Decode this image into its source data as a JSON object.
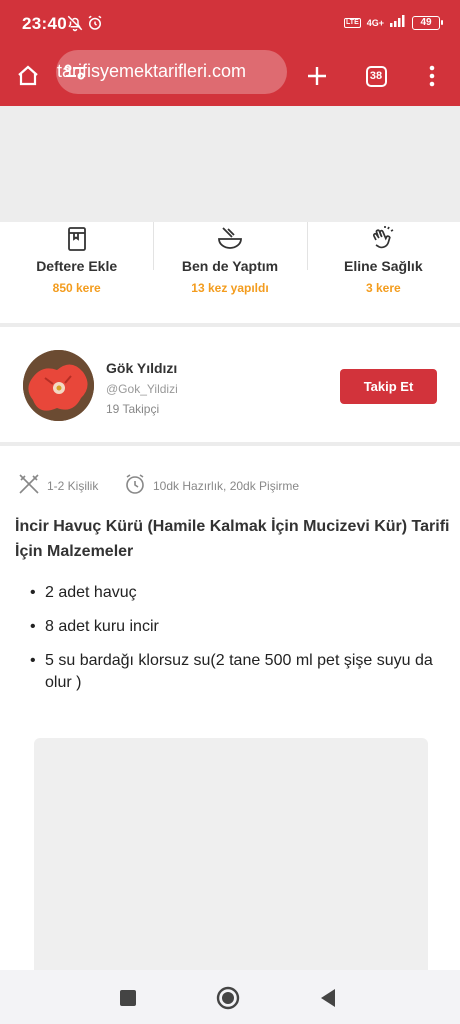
{
  "status_bar": {
    "time": "23:40",
    "volte": "LTE",
    "network": "4G+",
    "battery": "49"
  },
  "browser": {
    "url": "tarifisyemektarifleri.com",
    "tab_count": "38"
  },
  "actions": [
    {
      "label": "Deftere Ekle",
      "count": "850 kere",
      "icon": "notebook-icon"
    },
    {
      "label": "Ben de Yaptım",
      "count": "13 kez yapıldı",
      "icon": "bowl-whisk-icon"
    },
    {
      "label": "Eline Sağlık",
      "count": "3 kere",
      "icon": "clap-icon"
    }
  ],
  "author": {
    "name": "Gök Yıldızı",
    "handle": "@Gok_Yildizi",
    "followers": "19 Takipçi",
    "follow_label": "Takip Et"
  },
  "meta": {
    "servings": "1-2 Kişilik",
    "time": "10dk Hazırlık, 20dk Pişirme"
  },
  "recipe": {
    "title": "İncir Havuç Kürü (Hamile Kalmak İçin Mucizevi Kür) Tarifi İçin Malzemeler",
    "ingredients": [
      "2 adet havuç",
      "8 adet kuru incir",
      "5 su bardağı  klorsuz su(2 tane 500 ml pet şişe suyu da olur )"
    ]
  },
  "colors": {
    "brand_red": "#d2333b",
    "accent_orange": "#f39c1e"
  }
}
